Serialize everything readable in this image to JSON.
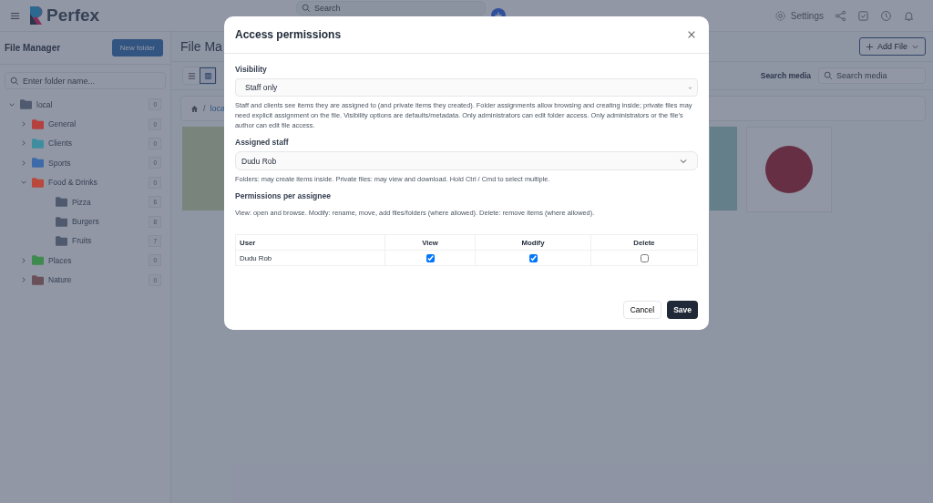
{
  "header": {
    "brand": "Perfex",
    "search": {
      "placeholder": "Search"
    },
    "settings_label": "Settings"
  },
  "sidebar": {
    "title": "File Manager",
    "new_folder_button": "New folder",
    "search": {
      "placeholder": "Enter folder name..."
    },
    "tree": [
      {
        "name": "local",
        "count": "0",
        "color": "#4f5a6e",
        "expanded": true,
        "children": [
          {
            "name": "General",
            "count": "0",
            "color": "#b4403f",
            "expanded": false
          },
          {
            "name": "Clients",
            "count": "0",
            "color": "#3f8ea0",
            "expanded": false
          },
          {
            "name": "Sports",
            "count": "0",
            "color": "#3d6aa8",
            "expanded": false
          },
          {
            "name": "Food & Drinks",
            "count": "0",
            "color": "#b8493c",
            "expanded": true,
            "children": [
              {
                "name": "Pizza",
                "count": "6",
                "color": "#4f5a6e"
              },
              {
                "name": "Burgers",
                "count": "8",
                "color": "#4f5a6e"
              },
              {
                "name": "Fruits",
                "count": "7",
                "color": "#4f5a6e"
              }
            ]
          },
          {
            "name": "Places",
            "count": "0",
            "color": "#3f8a4f",
            "expanded": false
          },
          {
            "name": "Nature",
            "count": "0",
            "color": "#6a5058",
            "expanded": false
          }
        ]
      }
    ]
  },
  "main": {
    "title": "File Ma",
    "add_file_button": "Add File",
    "view_modes": [
      {
        "kind": "list",
        "selected": false
      },
      {
        "kind": "grid",
        "selected": true
      }
    ],
    "search_label": "Search media",
    "search": {
      "placeholder": "Search media"
    },
    "breadcrumb": {
      "separator": "/",
      "items": [
        "loca"
      ]
    }
  },
  "dialog": {
    "title": "Access permissions",
    "visibility": {
      "label": "Visibility",
      "value": "Staff only",
      "help": "Staff and clients see items they are assigned to (and private items they created). Folder assignments allow browsing and creating inside; private files may need explicit assignment on the file. Visibility options are defaults/metadata. Only administrators can edit folder access. Only administrators or the file's author can edit file access."
    },
    "assigned_staff": {
      "label": "Assigned staff",
      "value": "Dudu Rob",
      "help": "Folders: may create items inside. Private files: may view and download. Hold Ctrl / Cmd to select multiple."
    },
    "permissions": {
      "label": "Permissions per assignee",
      "help": "View: open and browse. Modify: rename, move, add files/folders (where allowed). Delete: remove items (where allowed).",
      "columns": [
        "User",
        "View",
        "Modify",
        "Delete"
      ],
      "rows": [
        {
          "user": "Dudu Rob",
          "view": true,
          "modify": true,
          "delete": false
        }
      ]
    },
    "buttons": {
      "cancel": "Cancel",
      "save": "Save"
    }
  }
}
